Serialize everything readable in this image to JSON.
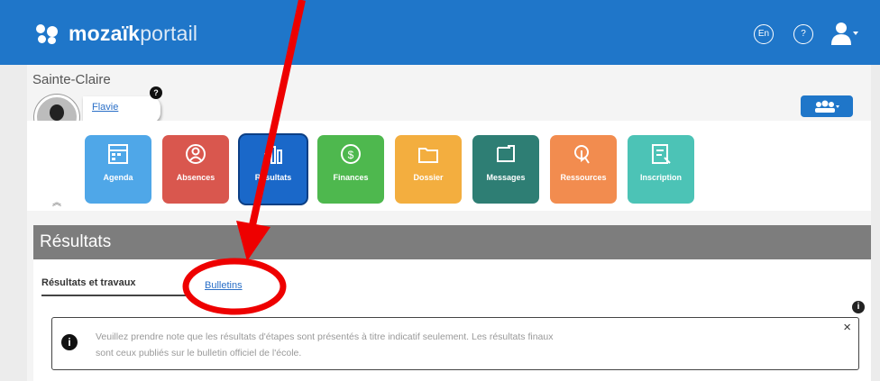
{
  "header": {
    "brand_bold": "mozaïk",
    "brand_light": "portail",
    "lang_button": "En",
    "help_button": "?"
  },
  "profile": {
    "school": "Sainte-Claire",
    "child_name": "Flavie",
    "help_badge": "?"
  },
  "tiles": [
    {
      "label": "Agenda",
      "color": "#4fa7e8",
      "icon": "calendar-icon"
    },
    {
      "label": "Absences",
      "color": "#d9574e",
      "icon": "user-circle-icon"
    },
    {
      "label": "Résultats",
      "color": "#1a68c9",
      "icon": "bar-chart-icon"
    },
    {
      "label": "Finances",
      "color": "#4eb84e",
      "icon": "coin-icon"
    },
    {
      "label": "Dossier",
      "color": "#f3ae3f",
      "icon": "folder-icon"
    },
    {
      "label": "Messages",
      "color": "#2e7e74",
      "icon": "message-icon"
    },
    {
      "label": "Ressources",
      "color": "#f28c4f",
      "icon": "touch-icon"
    },
    {
      "label": "Inscription",
      "color": "#4cc3b6",
      "icon": "form-icon"
    }
  ],
  "section": {
    "title": "Résultats",
    "tab_results": "Résultats et travaux",
    "tab_bulletins": "Bulletins"
  },
  "notice": {
    "line1": "Veuillez prendre note que les résultats d'étapes sont présentés à titre indicatif seulement. Les résultats finaux",
    "line2": "sont ceux publiés sur le bulletin officiel de l'école.",
    "close": "×"
  }
}
